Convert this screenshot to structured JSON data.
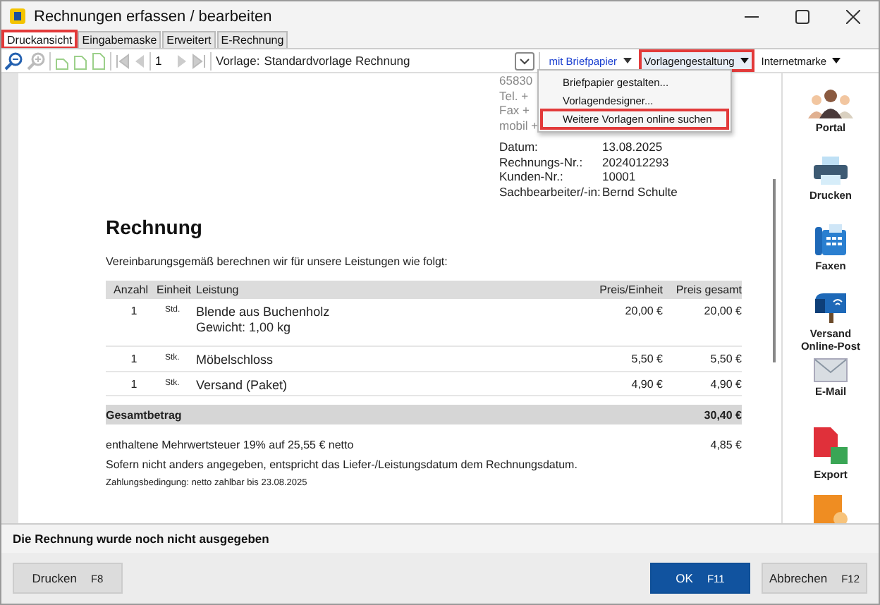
{
  "window": {
    "title": "Rechnungen erfassen / bearbeiten"
  },
  "tabs": [
    {
      "label": "Druckansicht",
      "selected": true,
      "highlighted": true
    },
    {
      "label": "Eingabemaske",
      "selected": false,
      "highlighted": false
    },
    {
      "label": "Erweitert",
      "selected": false,
      "highlighted": false
    },
    {
      "label": "E-Rechnung",
      "selected": false,
      "highlighted": false
    }
  ],
  "toolbar": {
    "page": "1",
    "template_label": "Vorlage:",
    "template": "Standardvorlage Rechnung",
    "buttons": [
      {
        "label": "mit Briefpapier",
        "kind": "link",
        "expanded": false,
        "highlighted": false
      },
      {
        "label": "Vorlagengestaltung",
        "kind": "menu",
        "expanded": true,
        "highlighted": true
      },
      {
        "label": "Internetmarke",
        "kind": "menu",
        "expanded": false,
        "highlighted": false
      }
    ]
  },
  "menu": {
    "items": [
      {
        "label": "Briefpapier gestalten...",
        "highlighted": false
      },
      {
        "label": "Vorlagendesigner...",
        "highlighted": false
      },
      {
        "label": "Weitere Vorlagen online suchen",
        "highlighted": true
      }
    ]
  },
  "document": {
    "sender_lines": [
      "65830",
      "Tel. +",
      "Fax +",
      "mobil +"
    ],
    "info": [
      {
        "label": "Datum:",
        "value": "13.08.2025"
      },
      {
        "label": "Rechnungs-Nr.:",
        "value": "2024012293"
      },
      {
        "label": "Kunden-Nr.:",
        "value": "10001"
      },
      {
        "label": "Sachbearbeiter/-in:",
        "value": "Bernd Schulte"
      }
    ],
    "title": "Rechnung",
    "intro": "Vereinbarungsgemäß berechnen wir für unsere Leistungen wie folgt:",
    "table": {
      "columns": [
        "Anzahl",
        "Einheit",
        "Leistung",
        "Preis/Einheit",
        "Preis gesamt"
      ],
      "rows": [
        {
          "qty": "1",
          "unit": "Std.",
          "lines": [
            "Blende aus Buchenholz",
            "Gewicht: 1,00 kg"
          ],
          "price": "20,00 €",
          "total": "20,00 €"
        },
        {
          "qty": "1",
          "unit": "Stk.",
          "lines": [
            "Möbelschloss"
          ],
          "price": "5,50 €",
          "total": "5,50 €"
        },
        {
          "qty": "1",
          "unit": "Stk.",
          "lines": [
            "Versand (Paket)"
          ],
          "price": "4,90 €",
          "total": "4,90 €"
        }
      ]
    },
    "total": {
      "label": "Gesamtbetrag",
      "value": "30,40 €"
    },
    "vat": {
      "text": "enthaltene Mehrwertsteuer 19% auf 25,55 € netto",
      "value": "4,85 €"
    },
    "note": "Sofern nicht anders angegeben, entspricht das Liefer-/Leistungsdatum dem Rechnungsdatum.",
    "payment": "Zahlungsbedingung: netto zahlbar bis 23.08.2025"
  },
  "side_actions": [
    {
      "label": "Portal",
      "kind": "portal"
    },
    {
      "label": "Drucken",
      "kind": "printer"
    },
    {
      "label": "Faxen",
      "kind": "fax"
    },
    {
      "label": "Versand\nOnline-Post",
      "kind": "mailbox"
    },
    {
      "label": "E-Mail",
      "kind": "mail"
    },
    {
      "label": "Export",
      "kind": "export"
    },
    {
      "kind": "package"
    }
  ],
  "status": "Die Rechnung wurde noch nicht ausgegeben",
  "buttons": [
    {
      "label": "Drucken",
      "key": "F8",
      "kind": "secondary"
    },
    {
      "label": "OK",
      "key": "F11",
      "kind": "primary"
    },
    {
      "label": "Abbrechen",
      "key": "F12",
      "kind": "secondary"
    }
  ]
}
